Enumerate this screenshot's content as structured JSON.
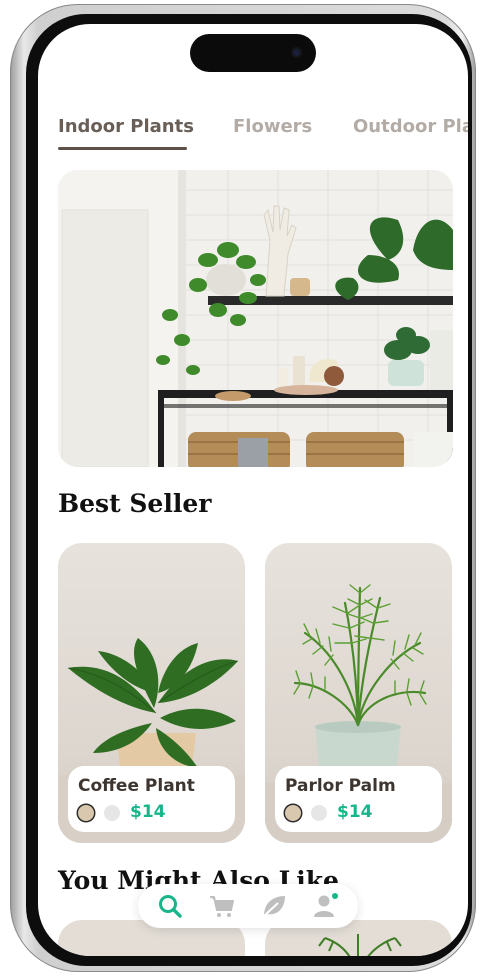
{
  "tabs": [
    {
      "label": "Indoor Plants",
      "active": true
    },
    {
      "label": "Flowers",
      "active": false
    },
    {
      "label": "Outdoor Plants",
      "active": false
    }
  ],
  "sections": {
    "best_seller": "Best Seller",
    "you_might_also_like": "You Might Also Like"
  },
  "products": [
    {
      "name": "Coffee Plant",
      "price": "$14",
      "colors": [
        "#d9c8ad",
        "#e6e6e6"
      ]
    },
    {
      "name": "Parlor Palm",
      "price": "$14",
      "colors": [
        "#d9c8ad",
        "#e6e6e6"
      ]
    }
  ],
  "nav": {
    "items": [
      "search-icon",
      "cart-icon",
      "leaf-icon",
      "profile-icon"
    ],
    "active": "search-icon",
    "accent": "#17b58a"
  }
}
